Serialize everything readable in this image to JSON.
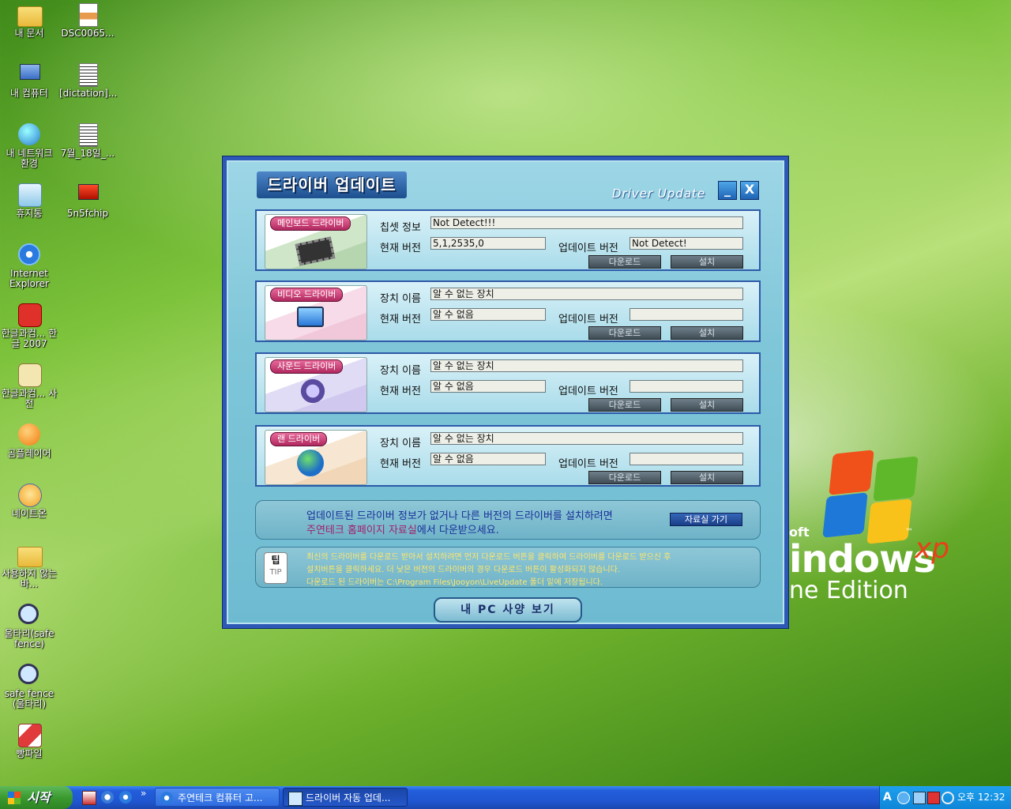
{
  "desktop": {
    "icons": [
      {
        "label": "내 문서"
      },
      {
        "label": "DSC0065..."
      },
      {
        "label": "내 컴퓨터"
      },
      {
        "label": "[dictation]..."
      },
      {
        "label": "내 네트워크 환경"
      },
      {
        "label": "7월_18일_..."
      },
      {
        "label": "휴지통"
      },
      {
        "label": "5n5fchip"
      },
      {
        "label": "Internet Explorer"
      },
      {
        "label": "한글과컴... 한글 2007"
      },
      {
        "label": "한글과컴... 사전"
      },
      {
        "label": "곰플레이어"
      },
      {
        "label": "네이트온"
      },
      {
        "label": "사용하지 않는 바..."
      },
      {
        "label": "울타리(safe fence)"
      },
      {
        "label": "safe fence (울타리)"
      },
      {
        "label": "빵파일"
      }
    ],
    "xp_logo": {
      "line1": "oft",
      "line2": "indows",
      "xp": "xp",
      "tm": "™",
      "edition": "ne Edition"
    }
  },
  "window": {
    "title_ko": "드라이버 업데이트",
    "title_en": "Driver Update",
    "min_label": "_",
    "close_label": "X",
    "panels": [
      {
        "tag": "메인보드 드라이버",
        "row1_label": "칩셋 정보",
        "row1_value": "Not Detect!!!",
        "row2_label": "현재 버전",
        "row2_value": "5,1,2535,0",
        "upd_label": "업데이트 버전",
        "upd_value": "Not Detect!",
        "download": "다운로드",
        "install": "설치"
      },
      {
        "tag": "비디오 드라이버",
        "row1_label": "장치 이름",
        "row1_value": "알 수 없는 장치",
        "row2_label": "현재 버전",
        "row2_value": "알 수 없음",
        "upd_label": "업데이트 버전",
        "upd_value": "",
        "download": "다운로드",
        "install": "설치"
      },
      {
        "tag": "사운드 드라이버",
        "row1_label": "장치 이름",
        "row1_value": "알 수 없는 장치",
        "row2_label": "현재 버전",
        "row2_value": "알 수 없음",
        "upd_label": "업데이트 버전",
        "upd_value": "",
        "download": "다운로드",
        "install": "설치"
      },
      {
        "tag": "랜 드라이버",
        "row1_label": "장치 이름",
        "row1_value": "알 수 없는 장치",
        "row2_label": "현재 버전",
        "row2_value": "알 수 없음",
        "upd_label": "업데이트 버전",
        "upd_value": "",
        "download": "다운로드",
        "install": "설치"
      }
    ],
    "notice": {
      "line1": "업데이트된 드라이버 정보가 없거나 다른 버전의 드라이버를 설치하려면",
      "line2_link": "주연테크 홈페이지 자료실",
      "line2_rest": "에서 다운받으세요.",
      "button": "자료실 가기"
    },
    "tip": {
      "badge_top": "팁",
      "badge_bottom": "TIP",
      "line1": "최신의 드라이버를 다운로드 받아서 설치하려면 먼저 다운로드 버튼을 클릭하여 드라이버를 다운로드 받으신 후",
      "line2": "설치버튼을 클릭하세요. 더 낮은 버전의 드라이버의 경우 다운로드 버튼이 활성화되지 않습니다.",
      "line3": "다운로드 된 드라이버는 C:\\Program Files\\Jooyon\\LiveUpdate 폴더 밑에 저장됩니다."
    },
    "spec_button": "내 PC 사양 보기"
  },
  "taskbar": {
    "start": "시작",
    "chevron": "»",
    "tasks": [
      {
        "label": "주연테크 컴퓨터 고..."
      },
      {
        "label": "드라이버 자동 업데..."
      }
    ],
    "tray": {
      "lang": "A",
      "time": "오후 12:32"
    }
  },
  "colors": {
    "accent": "#2e58b5",
    "notice_text": "#1a2f9a",
    "notice_link": "#a0206a",
    "tip_text": "#ffe66a"
  }
}
